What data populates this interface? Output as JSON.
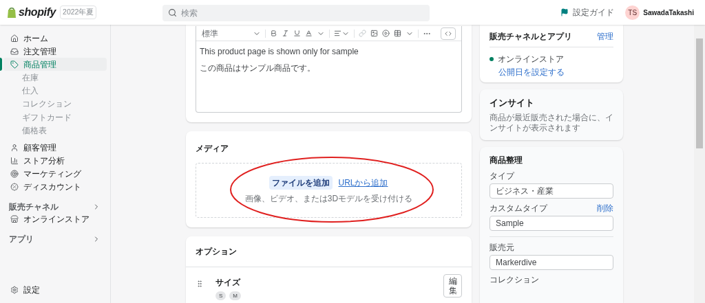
{
  "header": {
    "logo": "shopify",
    "edition_badge": "2022年夏",
    "search": {
      "placeholder": "検索"
    },
    "setup_guide": "設定ガイド",
    "user": {
      "initials": "TS",
      "name": "SawadaTakashi"
    }
  },
  "sidebar": {
    "items": [
      {
        "label": "ホーム",
        "selected": false
      },
      {
        "label": "注文管理",
        "selected": false
      },
      {
        "label": "商品管理",
        "selected": true,
        "children": [
          {
            "label": "在庫"
          },
          {
            "label": "仕入"
          },
          {
            "label": "コレクション"
          },
          {
            "label": "ギフトカード"
          },
          {
            "label": "価格表"
          }
        ]
      },
      {
        "label": "顧客管理",
        "selected": false
      },
      {
        "label": "ストア分析",
        "selected": false
      },
      {
        "label": "マーケティング",
        "selected": false
      },
      {
        "label": "ディスカウント",
        "selected": false
      }
    ],
    "sales_channels": {
      "title": "販売チャネル",
      "items": [
        {
          "label": "オンラインストア"
        }
      ]
    },
    "apps": {
      "title": "アプリ"
    },
    "settings": "設定"
  },
  "editor": {
    "style_select": "標準",
    "paragraphs": [
      "This product page is shown only for sample",
      "この商品はサンプル商品です。"
    ]
  },
  "media": {
    "title": "メディア",
    "add_file_button": "ファイルを追加",
    "add_url_link": "URLから追加",
    "hint": "画像、ビデオ、または3Dモデルを受け付ける"
  },
  "options": {
    "title": "オプション",
    "items": [
      {
        "name": "サイズ",
        "values": [
          "S",
          "M"
        ],
        "edit_button": "編集"
      }
    ]
  },
  "sales_channels_card": {
    "title": "販売チャネルとアプリ",
    "manage_link": "管理",
    "channels": [
      {
        "name": "オンラインストア",
        "color": "#008060",
        "schedule_link": "公開日を設定する"
      }
    ]
  },
  "insight": {
    "title": "インサイト",
    "text": "商品が最近販売された場合に、インサイトが表示されます"
  },
  "organization": {
    "title": "商品整理",
    "fields": [
      {
        "label": "タイプ",
        "value": "ビジネス・産業",
        "separated": false
      },
      {
        "label": "カスタムタイプ",
        "action": "削除",
        "value": "Sample",
        "separated": false
      },
      {
        "label": "販売元",
        "value": "Markerdive",
        "separated": true
      },
      {
        "label": "コレクション",
        "separated": false
      }
    ]
  }
}
